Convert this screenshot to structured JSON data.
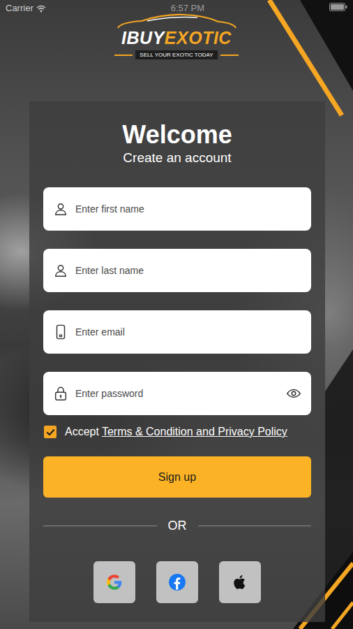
{
  "status_bar": {
    "carrier": "Carrier",
    "time": "6:57 PM"
  },
  "logo": {
    "name_part1": "IBUY",
    "name_part2": "EXOTIC",
    "tagline": "SELL YOUR EXOTIC TODAY"
  },
  "title": "Welcome",
  "subtitle": "Create an account",
  "fields": [
    {
      "kind": "name",
      "placeholder": "Enter first name"
    },
    {
      "kind": "name",
      "placeholder": "Enter last name"
    },
    {
      "kind": "email",
      "placeholder": "Enter email"
    },
    {
      "kind": "password",
      "placeholder": "Enter password"
    }
  ],
  "terms": {
    "checked": true,
    "prefix": "Accept",
    "link": "Terms & Condition and Privacy Policy"
  },
  "signup_button": "Sign up",
  "divider": "OR"
}
